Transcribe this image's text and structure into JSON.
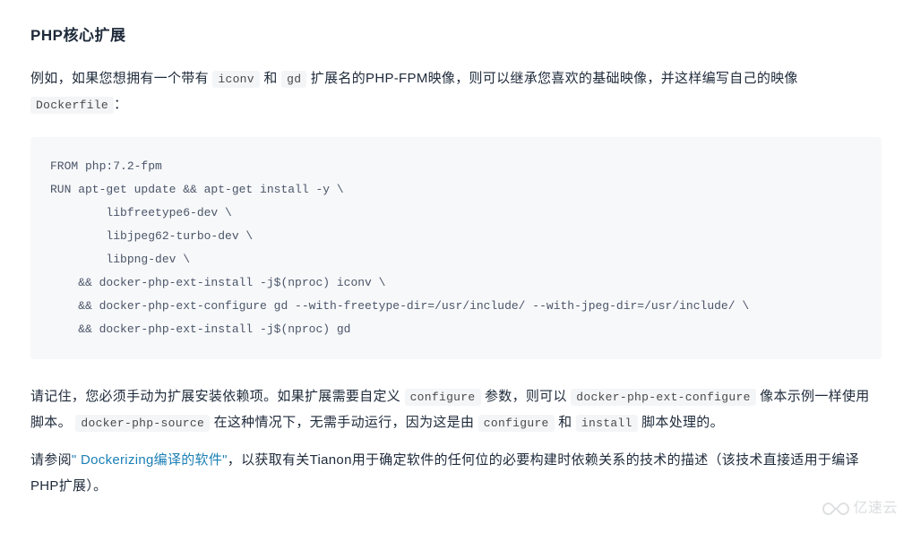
{
  "heading": "PHP核心扩展",
  "para1": {
    "t1": "例如，如果您想拥有一个带有 ",
    "code1": "iconv",
    "t2": " 和 ",
    "code2": "gd",
    "t3": " 扩展名的PHP-FPM映像，则可以继承您喜欢的基础映像，并这样编写自己的映像 ",
    "code3": "Dockerfile",
    "t4": "："
  },
  "codeblock": "FROM php:7.2-fpm\nRUN apt-get update && apt-get install -y \\\n        libfreetype6-dev \\\n        libjpeg62-turbo-dev \\\n        libpng-dev \\\n    && docker-php-ext-install -j$(nproc) iconv \\\n    && docker-php-ext-configure gd --with-freetype-dir=/usr/include/ --with-jpeg-dir=/usr/include/ \\\n    && docker-php-ext-install -j$(nproc) gd",
  "para2": {
    "t1": "请记住，您必须手动为扩展安装依赖项。如果扩展需要自定义 ",
    "code1": "configure",
    "t2": " 参数，则可以 ",
    "code2": "docker-php-ext-configure",
    "t3": " 像本示例一样使用脚本。 ",
    "code3": "docker-php-source",
    "t4": " 在这种情况下，无需手动运行，因为这是由 ",
    "code4": "configure",
    "t5": " 和 ",
    "code5": "install",
    "t6": " 脚本处理的。"
  },
  "para3": {
    "t1": "请参阅",
    "link": "\" Dockerizing编译的软件\"",
    "t2": "，以获取有关Tianon用于确定软件的任何位的必要构建时依赖关系的技术的描述（该技术直接适用于编译PHP扩展）。"
  },
  "watermark": {
    "brand": "亿速云"
  }
}
